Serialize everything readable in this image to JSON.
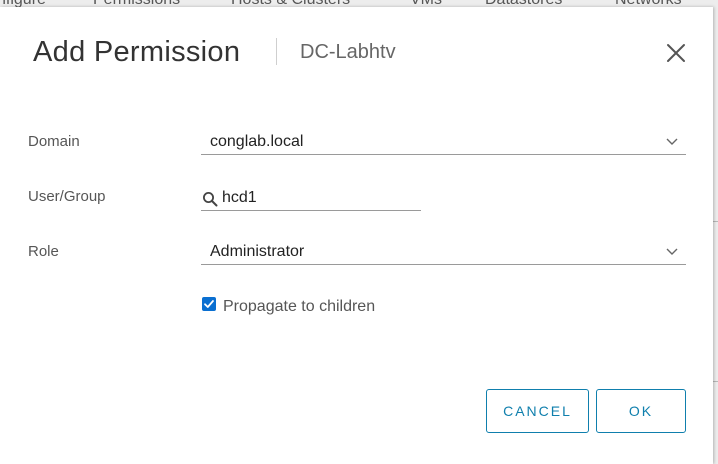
{
  "background": {
    "tabs": [
      "nfigure",
      "Permissions",
      "Hosts & Clusters",
      "VMs",
      "Datastores",
      "Networks"
    ]
  },
  "dialog": {
    "title": "Add Permission",
    "subtitle": "DC-Labhtv",
    "close_icon": "close-icon"
  },
  "form": {
    "domain": {
      "label": "Domain",
      "value": "conglab.local",
      "icon": "chevron-down-icon"
    },
    "user_group": {
      "label": "User/Group",
      "value": "hcd1",
      "icon": "search-icon"
    },
    "role": {
      "label": "Role",
      "value": "Administrator",
      "icon": "chevron-down-icon"
    },
    "propagate": {
      "label": "Propagate to children",
      "checked": true
    }
  },
  "buttons": {
    "cancel": "CANCEL",
    "ok": "OK"
  },
  "colors": {
    "accent": "#0f7fad",
    "checkbox": "#0a6fd1",
    "text": "#565656"
  }
}
